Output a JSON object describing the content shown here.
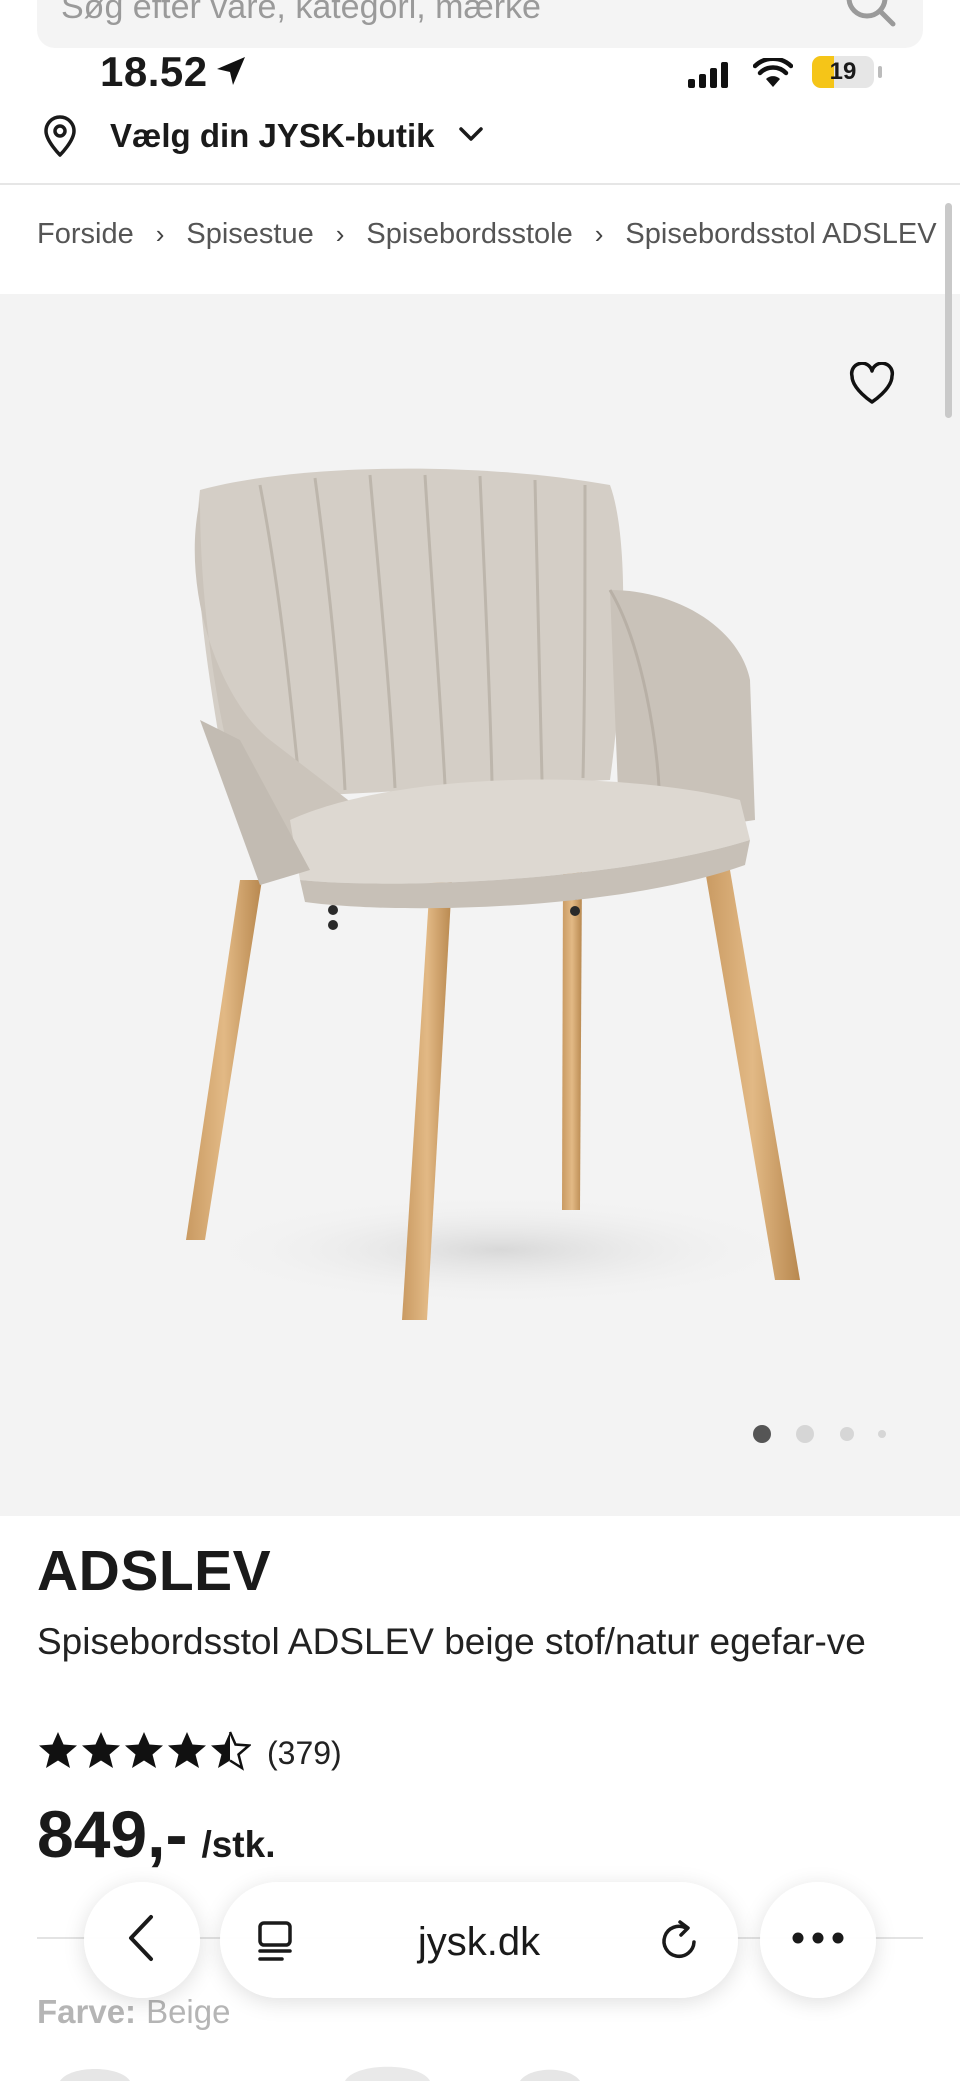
{
  "search": {
    "placeholder": "Søg efter vare, kategori, mærke"
  },
  "status_bar": {
    "time": "18.52",
    "battery": "19"
  },
  "store_selector": {
    "label": "Vælg din JYSK-butik",
    "icon": "location-pin-icon"
  },
  "breadcrumb": [
    "Forside",
    "Spisestue",
    "Spisebordsstole",
    "Spisebordsstol ADSLEV"
  ],
  "gallery": {
    "image_count": 4,
    "active_index": 0,
    "favorite_icon": "heart-outline-icon"
  },
  "product": {
    "name": "ADSLEV",
    "description": "Spisebordsstol ADSLEV beige stof/natur egefar-ve",
    "rating_stars": 4.5,
    "review_count": "(379)",
    "price": "849,-",
    "unit": "/stk.",
    "color_label": "Farve:",
    "color_value": "Beige"
  },
  "browser": {
    "domain": "jysk.dk"
  },
  "colors": {
    "accent_battery": "#f5c518",
    "gallery_bg": "#f3f3f3",
    "text": "#1a1a1a"
  }
}
